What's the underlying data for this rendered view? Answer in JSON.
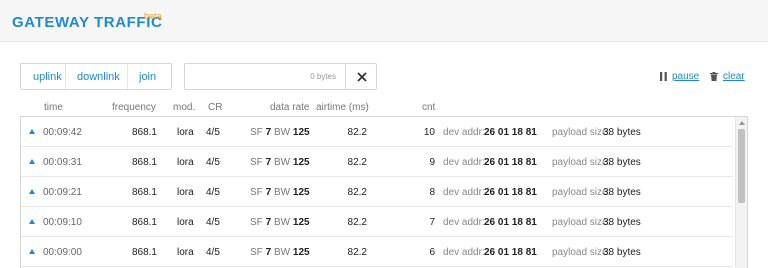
{
  "header": {
    "title": "GATEWAY TRAFFIC",
    "badge": "beta"
  },
  "filters": [
    "uplink",
    "downlink",
    "join"
  ],
  "search": {
    "value": "",
    "hint": "0 bytes",
    "clear_icon": "close-icon"
  },
  "actions": {
    "pause": "pause",
    "clear": "clear",
    "pause_icon": "pause-icon",
    "clear_icon": "trash-icon"
  },
  "columns": {
    "time": "time",
    "frequency": "frequency",
    "mod": "mod.",
    "cr": "CR",
    "data_rate": "data rate",
    "airtime": "airtime (ms)",
    "cnt": "cnt"
  },
  "rows": [
    {
      "direction_icon": "uplink-arrow-icon",
      "time": "00:09:42",
      "frequency": "868.1",
      "mod": "lora",
      "cr": "4/5",
      "sf_label": "SF",
      "sf": "7",
      "bw_label": "BW",
      "bw": "125",
      "airtime": "82.2",
      "cnt": "10",
      "dev_addr_label": "dev addr:",
      "dev_addr": "26 01 18 81",
      "payload_label": "payload size:",
      "payload": "38 bytes"
    },
    {
      "direction_icon": "uplink-arrow-icon",
      "time": "00:09:31",
      "frequency": "868.1",
      "mod": "lora",
      "cr": "4/5",
      "sf_label": "SF",
      "sf": "7",
      "bw_label": "BW",
      "bw": "125",
      "airtime": "82.2",
      "cnt": "9",
      "dev_addr_label": "dev addr:",
      "dev_addr": "26 01 18 81",
      "payload_label": "payload size:",
      "payload": "38 bytes"
    },
    {
      "direction_icon": "uplink-arrow-icon",
      "time": "00:09:21",
      "frequency": "868.1",
      "mod": "lora",
      "cr": "4/5",
      "sf_label": "SF",
      "sf": "7",
      "bw_label": "BW",
      "bw": "125",
      "airtime": "82.2",
      "cnt": "8",
      "dev_addr_label": "dev addr:",
      "dev_addr": "26 01 18 81",
      "payload_label": "payload size:",
      "payload": "38 bytes"
    },
    {
      "direction_icon": "uplink-arrow-icon",
      "time": "00:09:10",
      "frequency": "868.1",
      "mod": "lora",
      "cr": "4/5",
      "sf_label": "SF",
      "sf": "7",
      "bw_label": "BW",
      "bw": "125",
      "airtime": "82.2",
      "cnt": "7",
      "dev_addr_label": "dev addr:",
      "dev_addr": "26 01 18 81",
      "payload_label": "payload size:",
      "payload": "38 bytes"
    },
    {
      "direction_icon": "uplink-arrow-icon",
      "time": "00:09:00",
      "frequency": "868.1",
      "mod": "lora",
      "cr": "4/5",
      "sf_label": "SF",
      "sf": "7",
      "bw_label": "BW",
      "bw": "125",
      "airtime": "82.2",
      "cnt": "6",
      "dev_addr_label": "dev addr:",
      "dev_addr": "26 01 18 81",
      "payload_label": "payload size:",
      "payload": "38 bytes"
    }
  ],
  "colors": {
    "accent": "#1f8ad2",
    "badge": "#f0a030"
  }
}
